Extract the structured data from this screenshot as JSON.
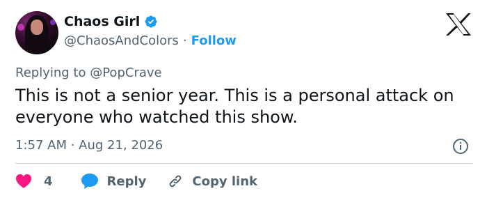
{
  "author": {
    "name": "Chaos Girl",
    "handle": "@ChaosAndColors",
    "separator": "·",
    "follow_label": "Follow"
  },
  "reply_context": {
    "prefix": "Replying to",
    "mention": "@PopCrave"
  },
  "tweet": {
    "text": "This is not a senior year. This is a personal attack on everyone who watched this show."
  },
  "meta": {
    "timestamp": "1:57 AM · Aug 21, 2026"
  },
  "actions": {
    "like_count": "4",
    "reply_label": "Reply",
    "copy_link_label": "Copy link"
  },
  "icons": {
    "verified": "verified-badge-icon",
    "logo": "x-logo-icon",
    "info": "info-icon",
    "like": "heart-icon",
    "reply": "speech-bubble-icon",
    "copy": "link-icon"
  },
  "colors": {
    "accent": "#1d9bf0",
    "like": "#f91880",
    "text": "#0f1419",
    "secondary": "#536471",
    "divider": "#cfd9de"
  }
}
